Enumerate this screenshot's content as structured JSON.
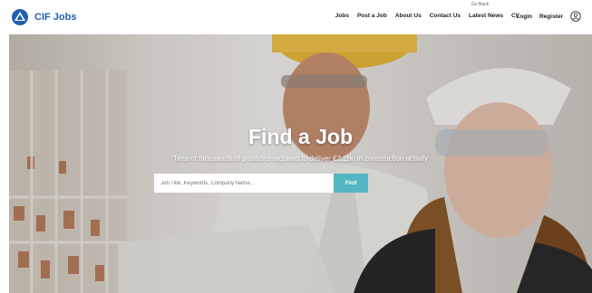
{
  "app": {
    "brand": "CIF Jobs"
  },
  "header": {
    "top_link": "Go Back",
    "nav": [
      {
        "label": "Jobs"
      },
      {
        "label": "Post a Job"
      },
      {
        "label": "About Us"
      },
      {
        "label": "Contact Us"
      },
      {
        "label": "Latest News"
      },
      {
        "label": "CV"
      }
    ],
    "login": "Login",
    "register": "Register"
  },
  "hero": {
    "title": "Find a Job",
    "subtitle": "Tens of thousands of positions required to deliver €2.2bn in construction activity",
    "search_placeholder": "Job Title, Keywords, Company Name...",
    "search_button": "Find"
  },
  "colors": {
    "brand": "#1f5fae",
    "search_button": "#52b6c3"
  }
}
